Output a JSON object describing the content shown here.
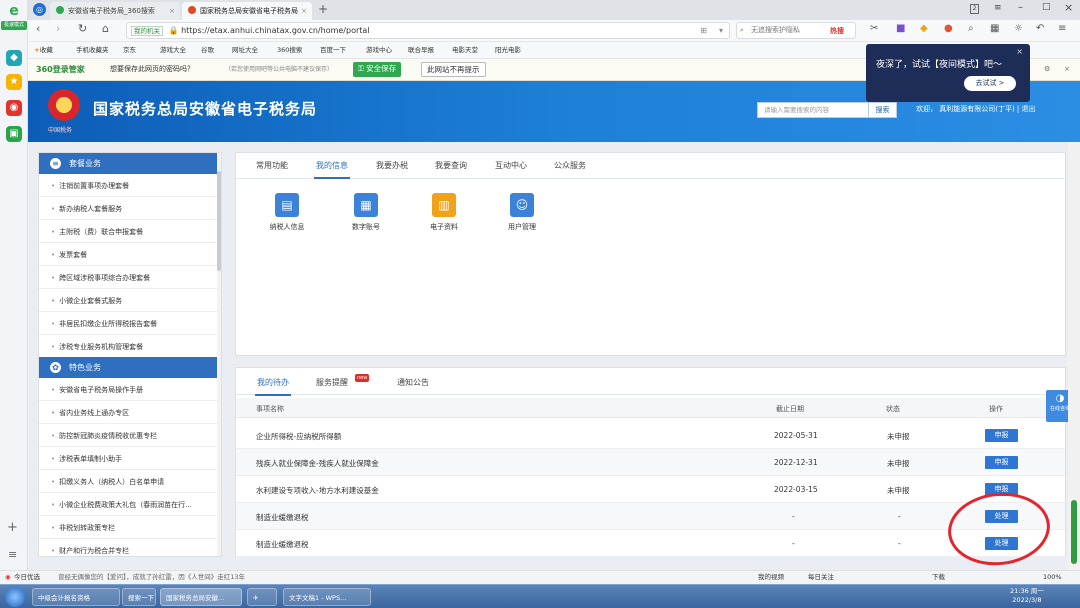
{
  "browser": {
    "left_logo": "e",
    "left_badge": "极速模式",
    "tabs": [
      {
        "label": "安徽省电子税务局_360搜索",
        "active": false
      },
      {
        "label": "国家税务总局安徽省电子税务局",
        "active": true
      }
    ],
    "new_tab": "+",
    "window_controls": [
      "2",
      "≡",
      "–",
      "□",
      "×"
    ],
    "url_prefix": "我的机关",
    "url": "https://etax.anhui.chinatax.gov.cn/home/portal",
    "search_placeholder": "无追搜索护隐私",
    "hot_label": "热搜",
    "bookmarks": [
      "收藏",
      "手机收藏夹",
      "京东",
      "游戏大全",
      "谷歌",
      "网址大全",
      "360搜索",
      "百度一下",
      "游戏中心",
      "联合早报",
      "电影天堂",
      "阳光电影"
    ],
    "pwbar": {
      "brand": "360登录管家",
      "question": "想要保存此网页的密码吗？",
      "note": "（若您使用网吧等公共电脑不建议保存）",
      "save_btn": "安全保存",
      "never_btn": "此网站不再提示"
    },
    "popup": {
      "text": "夜深了，试试【夜间模式】吧～",
      "button": "去试试 >"
    }
  },
  "site": {
    "title": "国家税务总局安徽省电子税务局",
    "emblem_caption": "中国税务",
    "search_placeholder": "请输入需要搜索的内容",
    "search_btn": "搜索",
    "welcome": "欢迎，  真利能源有限公司(丁平)   |   退出"
  },
  "sidebar": {
    "sections": [
      {
        "title": "套餐业务",
        "items": [
          "注销前置事项办理套餐",
          "新办纳税人套餐服务",
          "主附税（费）联合申报套餐",
          "发票套餐",
          "跨区域涉税事项综合办理套餐",
          "小微企业套餐式服务",
          "非居民扣缴企业所得税报告套餐",
          "涉税专业服务机构管理套餐"
        ]
      },
      {
        "title": "特色业务",
        "items": [
          "安徽省电子税务局操作手册",
          "省内业务线上通办专区",
          "防控新冠肺炎疫情税收优惠专栏",
          "涉税表单填制小助手",
          "扣缴义务人（纳税人）白名单申请",
          "小微企业税费政策大礼包（春雨润苗在行...",
          "非税划转政策专栏",
          "财产和行为税合并专栏"
        ]
      }
    ]
  },
  "panel1": {
    "tabs": [
      "常用功能",
      "我的信息",
      "我要办税",
      "我要查询",
      "互动中心",
      "公众服务"
    ],
    "active_tab": 1,
    "apps": [
      "纳税人信息",
      "数字账号",
      "电子资料",
      "用户管理"
    ]
  },
  "panel2": {
    "tabs": [
      "我的待办",
      "服务提醒",
      "通知公告"
    ],
    "new_badge": "new",
    "headers": [
      "事项名称",
      "截止日期",
      "状态",
      "操作"
    ],
    "rows": [
      {
        "name": "企业所得税-应纳税所得额",
        "date": "2022-05-31",
        "status": "未申报",
        "action": "申报"
      },
      {
        "name": "残疾人就业保障金-残疾人就业保障金",
        "date": "2022-12-31",
        "status": "未申报",
        "action": "申报"
      },
      {
        "name": "水利建设专项收入-地方水利建设基金",
        "date": "2022-03-15",
        "status": "未申报",
        "action": "申报"
      },
      {
        "name": "制造业缓缴退税",
        "date": "-",
        "status": "-",
        "action": "处理"
      },
      {
        "name": "制造业缓缴退税",
        "date": "-",
        "status": "-",
        "action": "处理"
      }
    ]
  },
  "online_service": "在线咨询",
  "status_bar": {
    "left": "今日优选",
    "news": "曾经无偶像您的【爱问】，成就了孙红雷，因《人世间》走红13年",
    "right": [
      "我的视频",
      "每日关注",
      "下载",
      "100%"
    ]
  },
  "taskbar": {
    "items": [
      "中级会计报名资格",
      "搜索一下",
      "国家税务总局安徽...",
      "",
      "文字文稿1 - WPS..."
    ],
    "time": "21:36 周一",
    "date": "2022/3/8"
  },
  "colors": {
    "brand": "#2f6fbf",
    "header": "#1d7fd6",
    "action": "#2f76d2",
    "highlight": "#e3262d"
  }
}
